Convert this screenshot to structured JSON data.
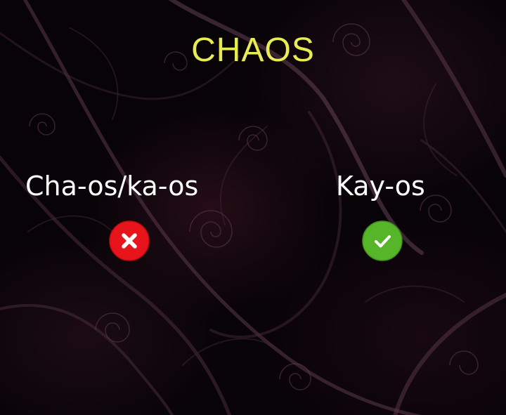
{
  "title": "CHAOS",
  "wrong": {
    "label": "Cha-os/ka-os",
    "icon": "cross-icon",
    "color": "#e8141c"
  },
  "right": {
    "label": "Kay-os",
    "icon": "checkmark-icon",
    "color": "#57b52a"
  },
  "colors": {
    "title": "#e6ec52",
    "text": "#ffffff",
    "background": "#070307"
  }
}
